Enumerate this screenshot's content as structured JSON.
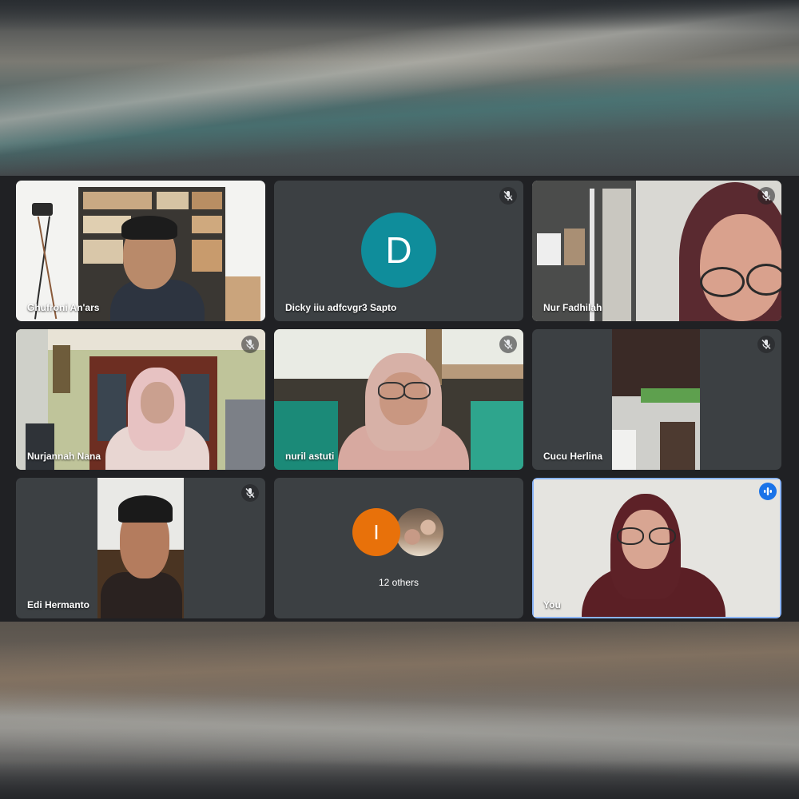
{
  "participants": [
    {
      "name": "Ghufroni An'ars",
      "muted": false
    },
    {
      "name": "Dicky iiu adfcvgr3 Sapto",
      "muted": true,
      "avatar_letter": "D",
      "avatar_color": "#0f8d9b"
    },
    {
      "name": "Nur Fadhilah",
      "muted": true
    },
    {
      "name": "Nurjannah Nana",
      "muted": true
    },
    {
      "name": "nuril astuti",
      "muted": true
    },
    {
      "name": "Cucu Herlina",
      "muted": true
    },
    {
      "name": "Edi Hermanto",
      "muted": true
    },
    {
      "name": "12 others",
      "avatar_letter": "I",
      "avatar_color": "#e8710a",
      "icon": "others-group"
    },
    {
      "name": "You",
      "speaking": true
    }
  ],
  "icons": {
    "muted": "mic-off-icon",
    "speaking": "audio-level-icon"
  },
  "colors": {
    "tile": "#3c4043",
    "grid_bg": "#202124",
    "active_border": "#8ab4f8",
    "speaking_badge": "#1a73e8"
  }
}
